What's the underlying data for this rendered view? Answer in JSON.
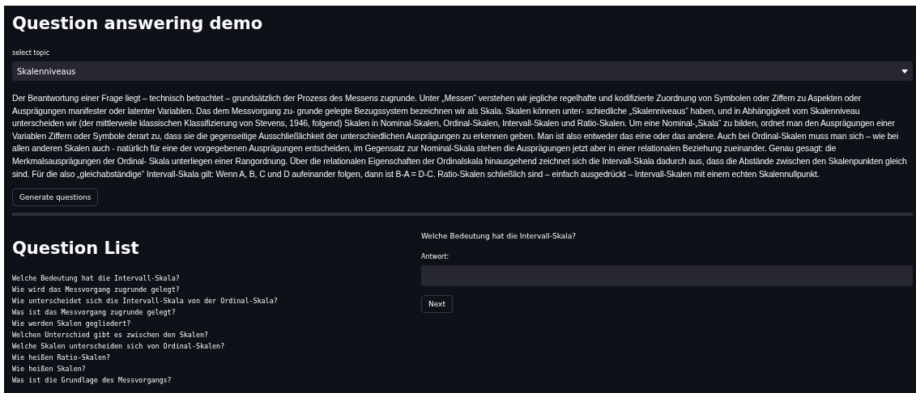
{
  "title": "Question answering demo",
  "topic_select": {
    "label": "select topic",
    "value": "Skalenniveaus"
  },
  "context": "Der Beantwortung einer Frage liegt – technisch betrachtet – grundsätzlich der Prozess des Messens zugrunde. Unter „Messen“ verstehen wir jegliche regelhafte und kodifizierte Zuordnung von Symbolen oder Ziffern zu Aspekten oder Ausprägungen manifester oder latenter Variablen. Das dem Messvorgang zu- grunde gelegte Bezugssystem bezeichnen wir als Skala. Skalen können unter- schiedliche „Skalenniveaus“ haben, und in Abhängigkeit vom Skalenniveau unterscheiden wir (der mittlerweile klassischen Klassifizierung von Stevens, 1946, folgend) Skalen in Nominal-Skalen, Ordinal-Skalen, Intervall-Skalen und Ratio-Skalen. Um eine Nominal-„Skala“ zu bilden, ordnet man den Ausprägungen einer Variablen Ziffern oder Symbole derart zu, dass sie die gegenseitige Ausschließlichkeit der unterschiedlichen Ausprägungen zu erkennen geben. Man ist also entweder das eine oder das andere. Auch bei Ordinal-Skalen muss man sich – wie bei allen anderen Skalen auch - natürlich für eine der vorgegebenen Ausprägungen entscheiden, im Gegensatz zur Nominal-Skala stehen die Ausprägungen jetzt aber in einer relationalen Beziehung zueinander. Genau gesagt: die Merkmalsausprägungen der Ordinal- Skala unterliegen einer Rangordnung. Über die relationalen Eigenschaften der Ordinalskala hinausgehend zeichnet sich die Intervall-Skala dadurch aus, dass die Abstände zwischen den Skalenpunkten gleich sind. Für die also „gleichabständige“ Intervall-Skala gilt: Wenn A, B, C und D aufeinander folgen, dann ist B-A = D-C. Ratio-Skalen schließlich sind – einfach ausgedrückt – Intervall-Skalen mit einem echten Skalennullpunkt.",
  "generate_button": "Generate questions",
  "question_list": {
    "heading": "Question List",
    "questions": [
      "Welche Bedeutung hat die Intervall-Skala?",
      "Wie wird das Messvorgang zugrunde gelegt?",
      "Wie unterscheidet sich die Intervall-Skala von der Ordinal-Skala?",
      "Was ist das Messvorgang zugrunde gelegt?",
      "Wie werden Skalen gegliedert?",
      "Welchen Unterschied gibt es zwischen den Skalen?",
      "Welche Skalen unterscheiden sich von Ordinal-Skalen?",
      "Wie heißen Ratio-Skalen?",
      "Wie heißen Skalen?",
      "Was ist die Grundlage des Messvorgangs?"
    ]
  },
  "answer_panel": {
    "question": "Welche Bedeutung hat die Intervall-Skala?",
    "answer_label": "Antwort:",
    "next_button": "Next"
  }
}
